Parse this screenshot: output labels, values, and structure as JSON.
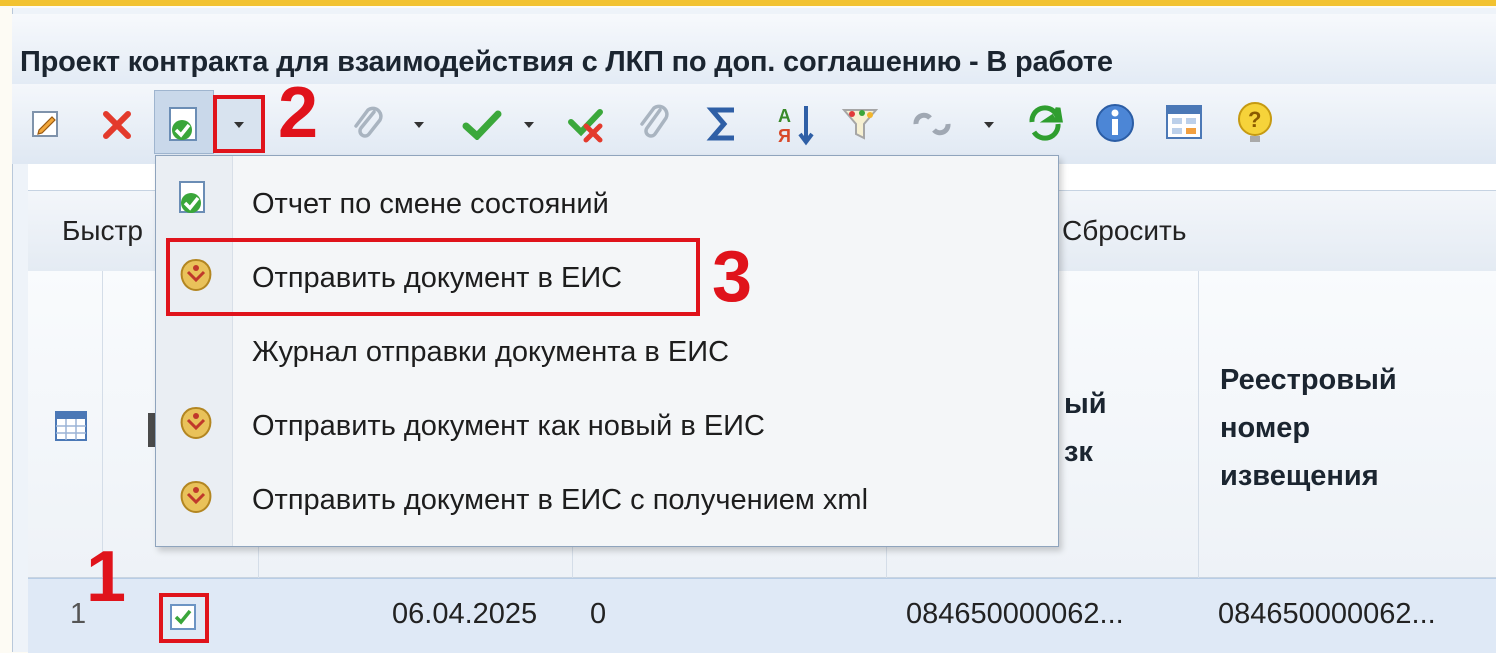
{
  "window": {
    "title": "Проект контракта для взаимодействия с ЛКП по доп. соглашению - В работе"
  },
  "toolbar": {
    "icons": [
      "edit-icon",
      "delete-icon",
      "change-state-icon",
      "attach-icon",
      "approve-icon",
      "reject-icon",
      "paperclip-icon",
      "sum-icon",
      "sort-icon",
      "filter-icon",
      "link-icon",
      "refresh-icon",
      "info-icon",
      "form-icon",
      "help-icon"
    ]
  },
  "filterbar": {
    "quick_label": "Быстр",
    "reset_label": "Сбросить"
  },
  "context_menu": {
    "items": [
      {
        "label": "Отчет по смене состояний",
        "icon": "state-report-icon"
      },
      {
        "label": "Отправить документ в ЕИС",
        "icon": "emblem-icon"
      },
      {
        "label": "Журнал отправки документа в ЕИС",
        "icon": ""
      },
      {
        "label": "Отправить документ как новый в ЕИС",
        "icon": "emblem-icon"
      },
      {
        "label": "Отправить документ в ЕИС с получением xml",
        "icon": "emblem-icon"
      }
    ]
  },
  "grid": {
    "headers": {
      "col_partial": [
        "ый",
        "зк"
      ],
      "registry_notice": [
        "Реестровый",
        "номер",
        "извещения"
      ]
    },
    "rows": [
      {
        "num": "1",
        "checked": true,
        "date": "06.04.2025",
        "value": "0",
        "code1": "084650000062...",
        "code2": "084650000062..."
      }
    ]
  },
  "annotations": {
    "step1": "1",
    "step2": "2",
    "step3": "3"
  },
  "colors": {
    "accent_red": "#e0131b",
    "top_border": "#f2c230",
    "selection": "#dfe9f6"
  }
}
